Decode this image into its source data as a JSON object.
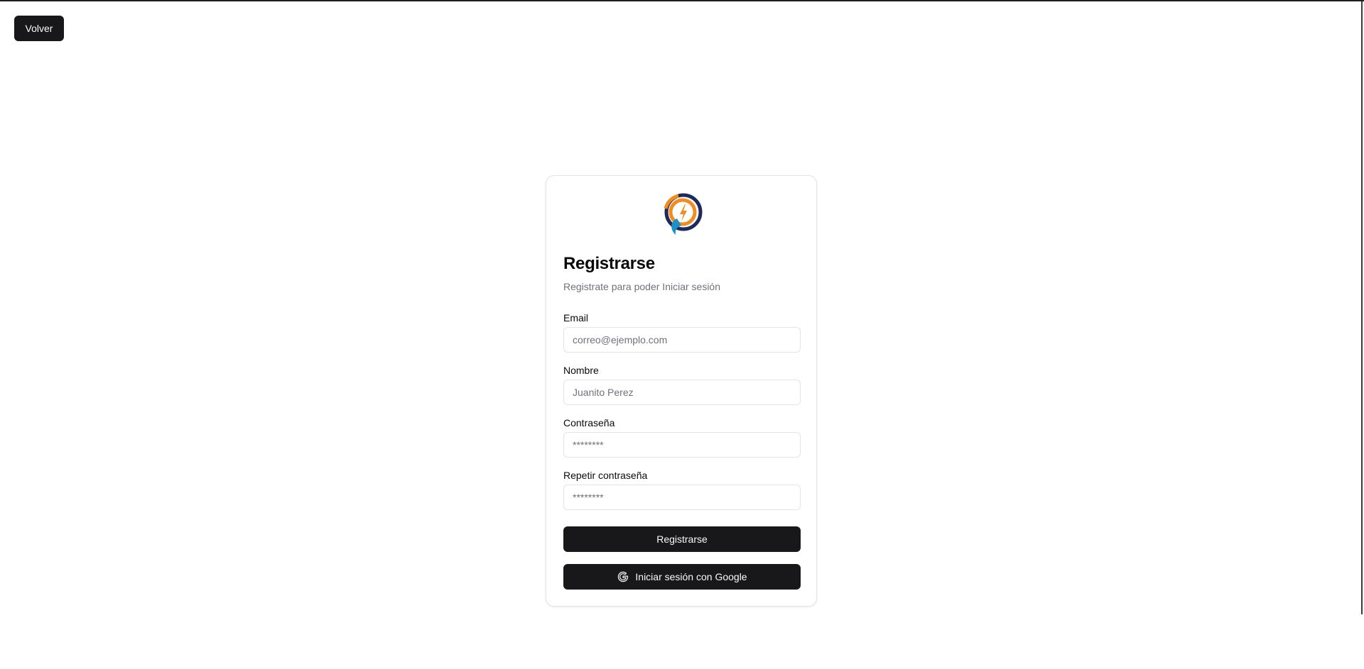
{
  "header": {
    "back_label": "Volver"
  },
  "card": {
    "title": "Registrarse",
    "subtitle": "Registrate para poder Iniciar sesión",
    "logo_icon": "lightning-circle-logo",
    "fields": {
      "email": {
        "label": "Email",
        "placeholder": "correo@ejemplo.com",
        "value": ""
      },
      "name": {
        "label": "Nombre",
        "placeholder": "Juanito Perez",
        "value": ""
      },
      "password": {
        "label": "Contraseña",
        "placeholder": "********",
        "value": ""
      },
      "confirm_password": {
        "label": "Repetir contraseña",
        "placeholder": "********",
        "value": ""
      }
    },
    "register_label": "Registrarse",
    "google_label": "Iniciar sesión con Google",
    "google_icon": "google-icon"
  },
  "colors": {
    "button_bg": "#18181b",
    "button_text": "#fafafa",
    "muted_text": "#71717a",
    "border": "#e4e4e7",
    "logo_navy": "#1e2a5a",
    "logo_orange": "#f28c1e",
    "logo_blue": "#1e90c8"
  }
}
